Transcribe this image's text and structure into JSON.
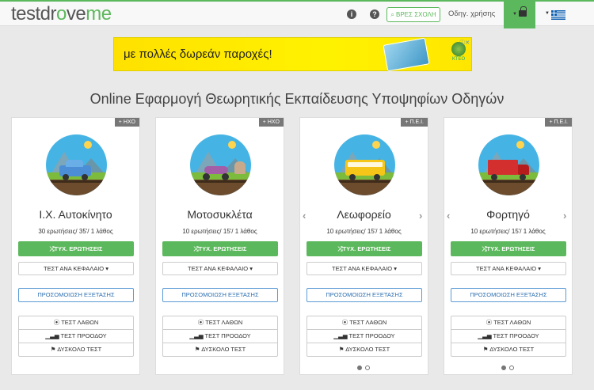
{
  "logo": {
    "part1": "testdr",
    "part2": "o",
    "part3": "ve",
    "part4": "me"
  },
  "nav": {
    "info_icon": "i",
    "help_icon": "?",
    "find_school_button": "⌕ ΒΡΕΣ ΣΧΟΛΗ",
    "guide_link": "Οδηγ. χρήσης",
    "cart_icon": "lock-icon",
    "language_flag": "greek-flag"
  },
  "ad": {
    "text": "με πολλές δωρεάν παροχές!",
    "logo_text": "ΚΤΕΟ",
    "close": "ⓘ✕"
  },
  "page_title": "Online Εφαρμογή Θεωρητικής Εκπαίδευσης Υποψηφίων Οδηγών",
  "cards": [
    {
      "badge": "+ ΗΧΟ",
      "title": "Ι.Χ. Αυτοκίνητο",
      "subtitle": "30 ερωτήσεις/ 35'/ 1 λάθος",
      "random_button": "⤮ΤΥΧ. ΕΡΩΤΗΣΕΙΣ",
      "chapter_button": "ΤΕΣΤ ΑΝΑ ΚΕΦΑΛΑΙΟ ▾",
      "exam_button": "ΠΡΟΣΟΜΟΙΩΣΗ ΕΞΕΤΑΣΗΣ",
      "errors_test": "⦿ ΤΕΣΤ ΛΑΘΩΝ",
      "progress_test": "▁▃▅ ΤΕΣΤ ΠΡΟΟΔΟΥ",
      "hard_test": "⚑ ΔΥΣΚΟΛΟ ΤΕΣΤ",
      "vehicle_color": "#4b8ed6"
    },
    {
      "badge": "+ ΗΧΟ",
      "title": "Μοτοσυκλέτα",
      "subtitle": "10 ερωτήσεις/ 15'/ 1 λάθος",
      "random_button": "⤮ΤΥΧ. ΕΡΩΤΗΣΕΙΣ",
      "chapter_button": "ΤΕΣΤ ΑΝΑ ΚΕΦΑΛΑΙΟ ▾",
      "exam_button": "ΠΡΟΣΟΜΟΙΩΣΗ ΕΞΕΤΑΣΗΣ",
      "errors_test": "⦿ ΤΕΣΤ ΛΑΘΩΝ",
      "progress_test": "▁▃▅ ΤΕΣΤ ΠΡΟΟΔΟΥ",
      "hard_test": "⚑ ΔΥΣΚΟΛΟ ΤΕΣΤ",
      "vehicle_color": "#a35ea8"
    },
    {
      "badge": "+ Π.Ε.Ι.",
      "title": "Λεωφορείο",
      "subtitle": "10 ερωτήσεις/ 15'/ 1 λάθος",
      "random_button": "⤮ΤΥΧ. ΕΡΩΤΗΣΕΙΣ",
      "chapter_button": "ΤΕΣΤ ΑΝΑ ΚΕΦΑΛΑΙΟ ▾",
      "exam_button": "ΠΡΟΣΟΜΟΙΩΣΗ ΕΞΕΤΑΣΗΣ",
      "errors_test": "⦿ ΤΕΣΤ ΛΑΘΩΝ",
      "progress_test": "▁▃▅ ΤΕΣΤ ΠΡΟΟΔΟΥ",
      "hard_test": "⚑ ΔΥΣΚΟΛΟ ΤΕΣΤ",
      "vehicle_color": "#f5c518"
    },
    {
      "badge": "+ Π.Ε.Ι.",
      "title": "Φορτηγό",
      "subtitle": "10 ερωτήσεις/ 15'/ 1 λάθος",
      "random_button": "⤮ΤΥΧ. ΕΡΩΤΗΣΕΙΣ",
      "chapter_button": "ΤΕΣΤ ΑΝΑ ΚΕΦΑΛΑΙΟ ▾",
      "exam_button": "ΠΡΟΣΟΜΟΙΩΣΗ ΕΞΕΤΑΣΗΣ",
      "errors_test": "⦿ ΤΕΣΤ ΛΑΘΩΝ",
      "progress_test": "▁▃▅ ΤΕΣΤ ΠΡΟΟΔΟΥ",
      "hard_test": "⚑ ΔΥΣΚΟΛΟ ΤΕΣΤ",
      "vehicle_color": "#d32f2f"
    }
  ],
  "carousel_arrows": {
    "left": "‹",
    "right": "›"
  },
  "colors": {
    "brand_green": "#5cb85c",
    "link_blue": "#2c6fb1",
    "badge_gray": "#777777"
  }
}
